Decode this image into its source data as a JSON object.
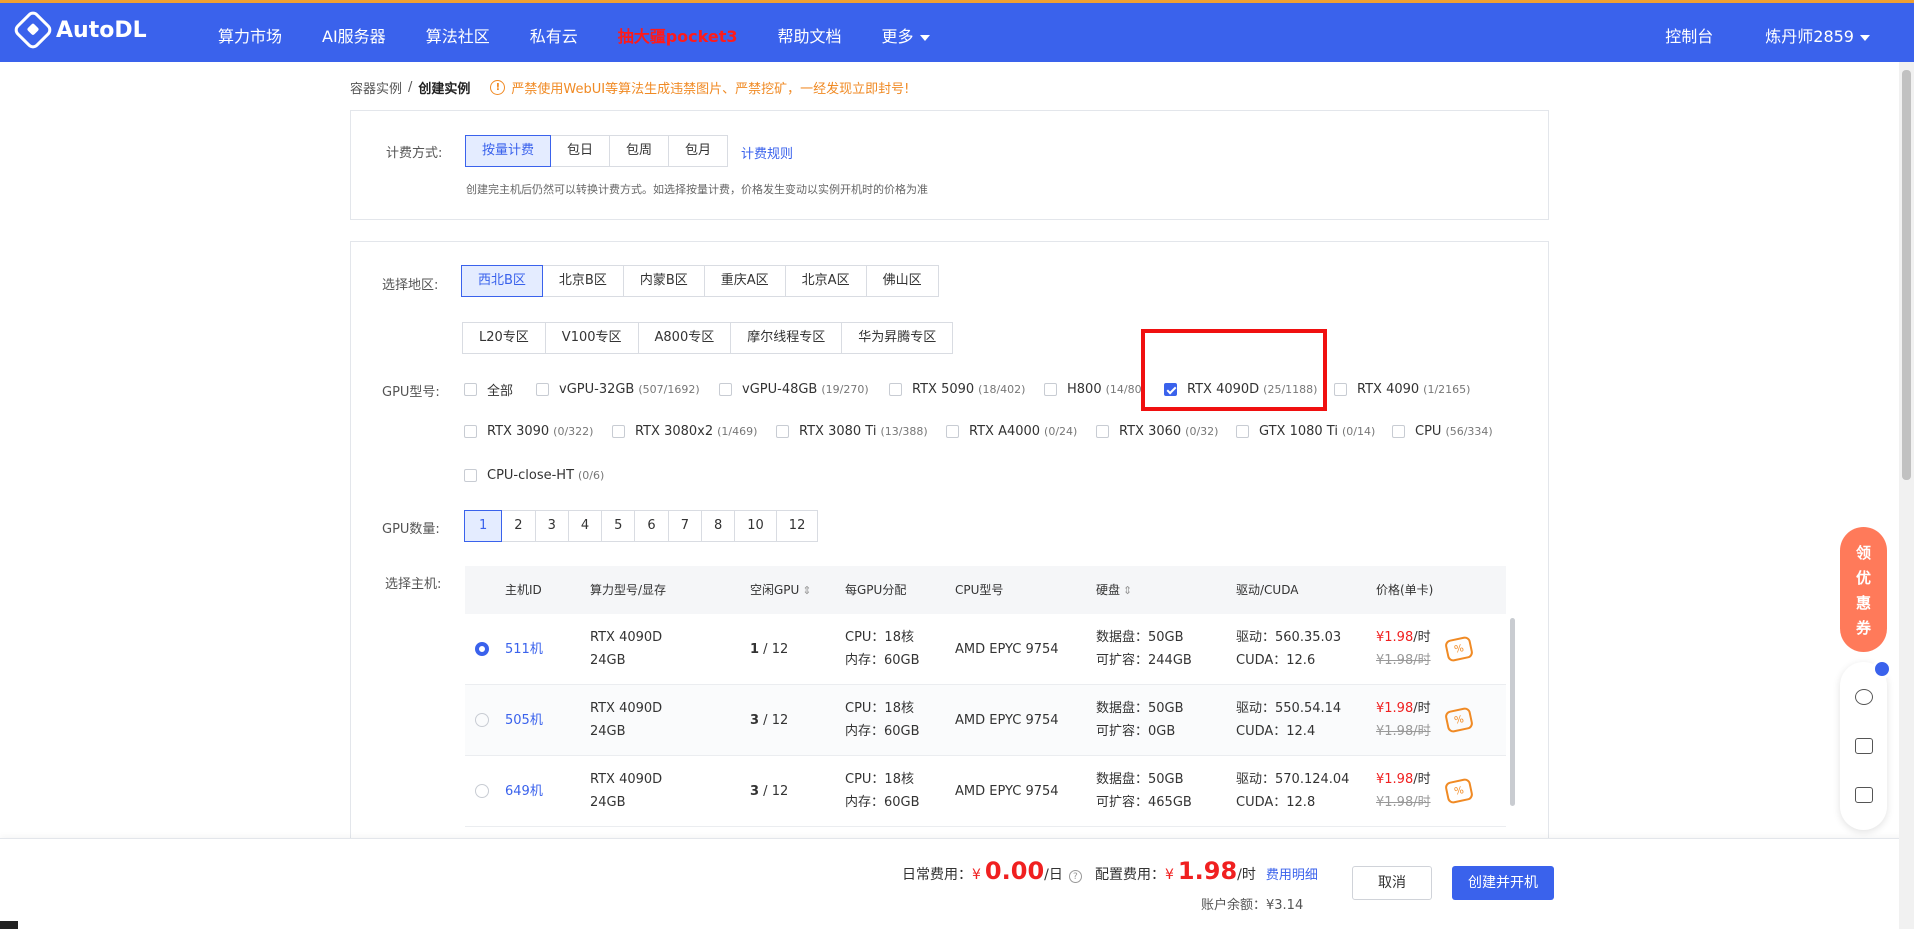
{
  "app": {
    "logo": "AutoDL"
  },
  "nav": {
    "items": [
      "算力市场",
      "AI服务器",
      "算法社区",
      "私有云"
    ],
    "hot": "抽大疆pocket3",
    "help": "帮助文档",
    "more": "更多"
  },
  "top_right": {
    "console": "控制台",
    "user": "炼丹师2859"
  },
  "breadcrumb": {
    "parent": "容器实例",
    "sep": "/",
    "current": "创建实例"
  },
  "warning": "严禁使用WebUI等算法生成违禁图片、严禁挖矿，一经发现立即封号!",
  "billing": {
    "label": "计费方式:",
    "options": [
      "按量计费",
      "包日",
      "包周",
      "包月"
    ],
    "selected": "按量计费",
    "rules_link": "计费规则",
    "hint": "创建完主机后仍然可以转换计费方式。如选择按量计费，价格发生变动以实例开机时的价格为准"
  },
  "region": {
    "label": "选择地区:",
    "row1": [
      "西北B区",
      "北京B区",
      "内蒙B区",
      "重庆A区",
      "北京A区",
      "佛山区"
    ],
    "row2": [
      "L20专区",
      "V100专区",
      "A800专区",
      "摩尔线程专区",
      "华为昇腾专区"
    ],
    "selected": "西北B区"
  },
  "gpu_model": {
    "label": "GPU型号:",
    "row1": [
      {
        "name": "全部",
        "count": ""
      },
      {
        "name": "vGPU-32GB",
        "count": "(507/1692)"
      },
      {
        "name": "vGPU-48GB",
        "count": "(19/270)"
      },
      {
        "name": "RTX 5090",
        "count": "(18/402)"
      },
      {
        "name": "H800",
        "count": "(14/80)"
      },
      {
        "name": "RTX 4090D",
        "count": "(25/1188)",
        "checked": true
      },
      {
        "name": "RTX 4090",
        "count": "(1/2165)"
      }
    ],
    "row2": [
      {
        "name": "RTX 3090",
        "count": "(0/322)"
      },
      {
        "name": "RTX 3080x2",
        "count": "(1/469)"
      },
      {
        "name": "RTX 3080 Ti",
        "count": "(13/388)"
      },
      {
        "name": "RTX A4000",
        "count": "(0/24)"
      },
      {
        "name": "RTX 3060",
        "count": "(0/32)"
      },
      {
        "name": "GTX 1080 Ti",
        "count": "(0/14)"
      },
      {
        "name": "CPU",
        "count": "(56/334)"
      }
    ],
    "row3": [
      {
        "name": "CPU-close-HT",
        "count": "(0/6)"
      }
    ]
  },
  "gpu_count": {
    "label": "GPU数量:",
    "options": [
      "1",
      "2",
      "3",
      "4",
      "5",
      "6",
      "7",
      "8",
      "10",
      "12"
    ],
    "selected": "1"
  },
  "host": {
    "label": "选择主机:",
    "columns": [
      "主机ID",
      "算力型号/显存",
      "空闲GPU",
      "每GPU分配",
      "CPU型号",
      "硬盘",
      "驱动/CUDA",
      "价格(单卡)"
    ],
    "rows": [
      {
        "id": "511机",
        "model": "RTX 4090D",
        "vram": "24GB",
        "free": "1",
        "total": " / 12",
        "cpu_cores": "CPU：18核",
        "mem": "内存：60GB",
        "cpu_model": "AMD EPYC 9754",
        "disk": "数据盘：50GB",
        "expand": "可扩容：244GB",
        "driver": "驱动：560.35.03",
        "cuda": "CUDA：12.6",
        "price": "¥1.98",
        "unit": "/时",
        "old_price": "¥1.98/时",
        "selected": true
      },
      {
        "id": "505机",
        "model": "RTX 4090D",
        "vram": "24GB",
        "free": "3",
        "total": " / 12",
        "cpu_cores": "CPU：18核",
        "mem": "内存：60GB",
        "cpu_model": "AMD EPYC 9754",
        "disk": "数据盘：50GB",
        "expand": "可扩容：0GB",
        "driver": "驱动：550.54.14",
        "cuda": "CUDA：12.4",
        "price": "¥1.98",
        "unit": "/时",
        "old_price": "¥1.98/时",
        "selected": false
      },
      {
        "id": "649机",
        "model": "RTX 4090D",
        "vram": "24GB",
        "free": "3",
        "total": " / 12",
        "cpu_cores": "CPU：18核",
        "mem": "内存：60GB",
        "cpu_model": "AMD EPYC 9754",
        "disk": "数据盘：50GB",
        "expand": "可扩容：465GB",
        "driver": "驱动：570.124.04",
        "cuda": "CUDA：12.8",
        "price": "¥1.98",
        "unit": "/时",
        "old_price": "¥1.98/时",
        "selected": false
      }
    ]
  },
  "footer": {
    "daily_label": "日常费用：",
    "daily_currency": "¥",
    "daily_value": "0.00",
    "daily_unit": "/日",
    "config_label": "配置费用：",
    "config_currency": "¥",
    "config_value": "1.98",
    "config_unit": "/时",
    "detail_link": "费用明细",
    "balance": "账户余额：¥3.14",
    "cancel": "取消",
    "create": "创建并开机"
  },
  "float_coupon": [
    "领",
    "优",
    "惠",
    "券"
  ]
}
